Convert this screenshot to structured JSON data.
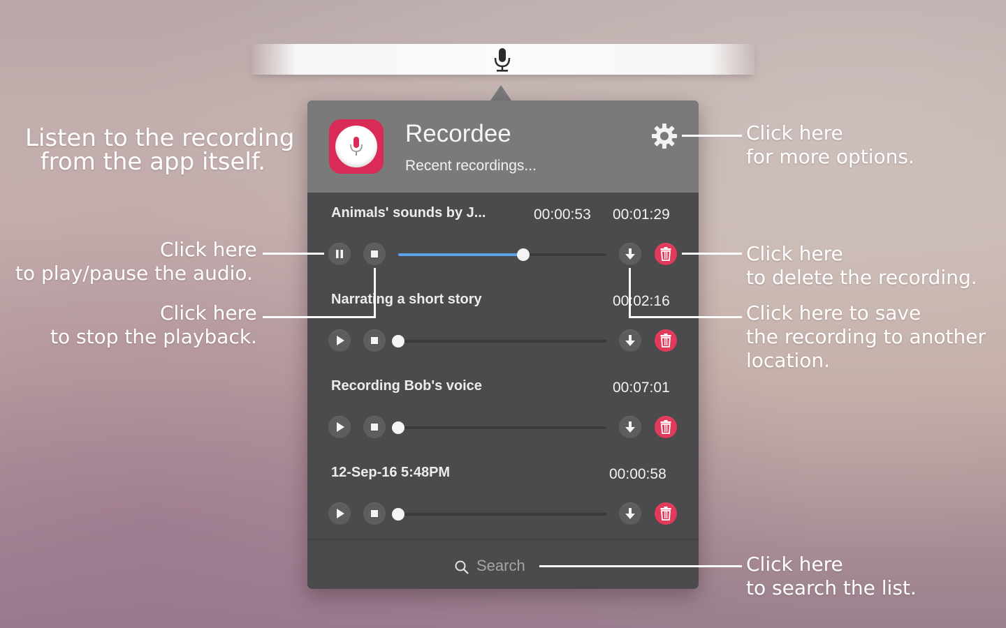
{
  "app": {
    "name": "Recordee",
    "subtitle": "Recent recordings..."
  },
  "recordings": [
    {
      "title": "Animals' sounds by J...",
      "elapsed": "00:00:53",
      "duration": "00:01:29",
      "progress": 0.6,
      "state": "playing"
    },
    {
      "title": "Narrating a short story",
      "elapsed": "",
      "duration": "00:02:16",
      "progress": 0.0,
      "state": "stopped"
    },
    {
      "title": "Recording Bob's voice",
      "elapsed": "",
      "duration": "00:07:01",
      "progress": 0.0,
      "state": "stopped"
    },
    {
      "title": "12-Sep-16  5:48PM",
      "elapsed": "",
      "duration": "00:00:58",
      "progress": 0.0,
      "state": "stopped"
    }
  ],
  "search": {
    "label": "Search"
  },
  "callouts": {
    "listen": "Listen to the recording\n  from the app itself.",
    "options_1": "Click here",
    "options_2": "for more options.",
    "play_1": "Click here",
    "play_2": "to play/pause the audio.",
    "stop_1": "Click here",
    "stop_2": "to stop the playback.",
    "delete_1": "Click here",
    "delete_2": "to delete the recording.",
    "save": "Click here to save\nthe recording to another\nlocation.",
    "search_1": "Click here",
    "search_2": "to search the list."
  },
  "icons": {
    "menubar": "microphone-icon",
    "app": "microphone-icon",
    "settings": "gear-icon",
    "play": "play-icon",
    "pause": "pause-icon",
    "stop": "stop-icon",
    "save": "download-arrow-icon",
    "delete": "trash-icon",
    "search": "magnifier-icon"
  },
  "colors": {
    "accent": "#5aa2e8",
    "delete": "#e23a5b",
    "app_icon": "#d92b55",
    "panel": "#4b4b4d",
    "header": "#7a7a7b"
  }
}
